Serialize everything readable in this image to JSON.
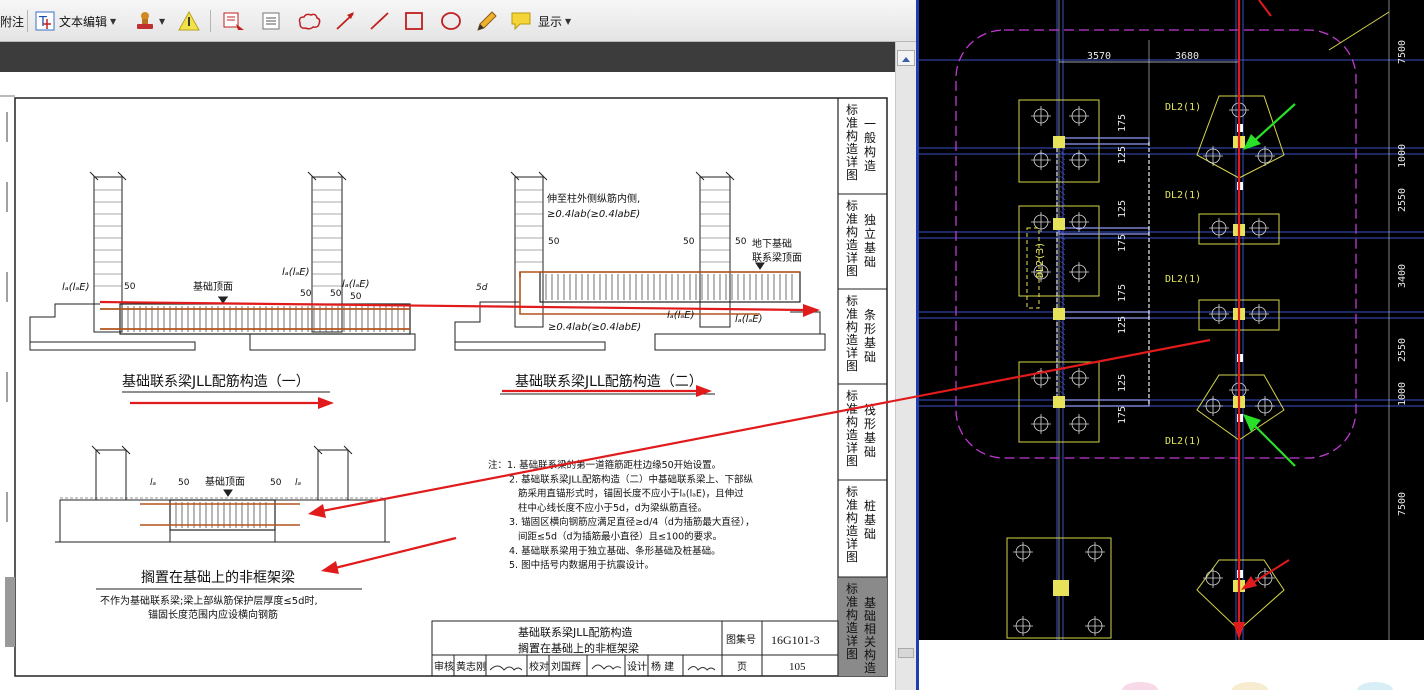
{
  "toolbar": {
    "annotate_label": "附注",
    "text_edit_label": "文本编辑",
    "display_label": "显示"
  },
  "pdf": {
    "side_tabs": [
      {
        "label": "标准构造详图",
        "sub": "一般构造"
      },
      {
        "label": "标准构造详图",
        "sub": "独立基础"
      },
      {
        "label": "标准构造详图",
        "sub": "条形基础"
      },
      {
        "label": "标准构造详图",
        "sub": "筏形基础"
      },
      {
        "label": "标准构造详图",
        "sub": "桩基础"
      },
      {
        "label": "标准构造详图",
        "sub": "基础相关构造"
      }
    ],
    "drawing1": {
      "title": "基础联系梁JLL配筋构造（一）",
      "top_label": "基础顶面",
      "la_left": "lₐ(lₐE)",
      "la_mid": "lₐ(lₐE)",
      "la_right": "lₐ(lₐE)",
      "dim_50a": "50",
      "dim_50b": "50",
      "dim_50c": "50",
      "dim_50d": "50"
    },
    "drawing2": {
      "title": "基础联系梁JLL配筋构造（二）",
      "note_top_1": "伸至柱外侧纵筋内侧,",
      "note_top_2": "≥0.4lab(≥0.4labE)",
      "note_bottom": "≥0.4lab(≥0.4labE)",
      "dim_50a": "50",
      "dim_50b": "50",
      "dim_50c": "50",
      "dim_5d": "5d",
      "beam_label_1": "地下基础",
      "beam_label_2": "联系梁顶面",
      "la_a": "lₐ(lₐE)",
      "la_b": "lₐ(lₐE)"
    },
    "drawing3": {
      "title": "搁置在基础上的非框架梁",
      "top_label": "基础顶面",
      "la_a": "lₐ",
      "la_b": "lₐ",
      "dim_50a": "50",
      "dim_50b": "50",
      "caption_1": "不作为基础联系梁;梁上部纵筋保护层厚度≤5d时,",
      "caption_2": "锚固长度范围内应设横向钢筋"
    },
    "notes": [
      "注：1. 基础联系梁的第一道箍筋距柱边缘50开始设置。",
      "2. 基础联系梁JLL配筋构造（二）中基础联系梁上、下部纵",
      "筋采用直锚形式时，锚固长度不应小于lₐ(lₐE)，且伸过",
      "柱中心线长度不应小于5d，d为梁纵筋直径。",
      "3. 锚固区横向钢筋应满足直径≥d/4（d为插筋最大直径），",
      "间距≤5d（d为插筋最小直径）且≤100的要求。",
      "4. 基础联系梁用于独立基础、条形基础及桩基础。",
      "5. 图中括号内数据用于抗震设计。"
    ],
    "titleblock": {
      "title_1": "基础联系梁JLL配筋构造",
      "title_2": "搁置在基础上的非框架梁",
      "atlas_label": "图集号",
      "atlas_no": "16G101-3",
      "review_label": "审核",
      "reviewer": "黄志刚",
      "check_label": "校对",
      "checker": "刘国辉",
      "design_label": "设计",
      "designer": "杨  建",
      "page_label": "页",
      "page_no": "105"
    }
  },
  "cad": {
    "dim_top_1": "3570",
    "dim_top_2": "3680",
    "beam_labels": [
      "DL2(1)",
      "DL2(1)",
      "DL2(1)",
      "DL2(1)"
    ],
    "vertical_beam_label": "DL2(3)",
    "dims_vertical": [
      "175",
      "125",
      "125",
      "175",
      "175",
      "125",
      "125",
      "175"
    ],
    "dims_right": [
      "7500",
      "1000",
      "2550",
      "3400",
      "2550",
      "1000",
      "7500"
    ]
  },
  "colors": {
    "annotation_red": "#e11b1b",
    "cad_green_arrow": "#29e029",
    "cad_yellow": "#e6e35a",
    "cad_magenta": "#c03ad0",
    "title_block_gray": "#8a8a8a"
  }
}
